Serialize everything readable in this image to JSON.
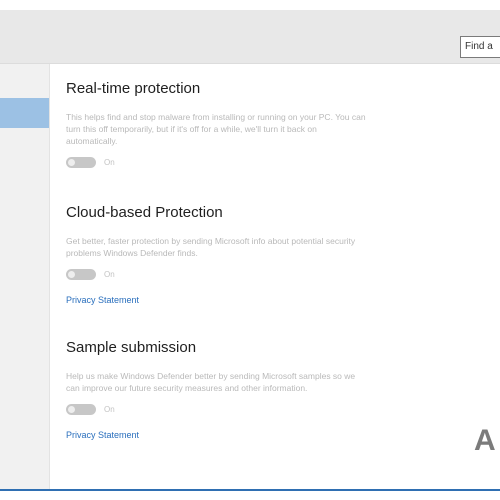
{
  "window": {
    "search": {
      "value": "Find a"
    }
  },
  "sections": [
    {
      "title": "Real-time protection",
      "description": "This helps find and stop malware from installing or running on your PC. You can turn this off temporarily, but if it's off for a while, we'll turn it back on automatically.",
      "toggle": {
        "state": "On",
        "value": true
      }
    },
    {
      "title": "Cloud-based Protection",
      "description": "Get better, faster protection by sending Microsoft info about potential security problems Windows Defender finds.",
      "toggle": {
        "state": "On",
        "value": true
      },
      "link": "Privacy Statement"
    },
    {
      "title": "Sample submission",
      "description": "Help us make Windows Defender better by sending Microsoft samples so we can improve our future security measures and other information.",
      "toggle": {
        "state": "On",
        "value": true
      },
      "link": "Privacy Statement"
    }
  ],
  "watermark": {
    "text": "A"
  },
  "colors": {
    "accent": "#2f6fb2",
    "sidebar_selected": "#9cc1e4",
    "link": "#2a6fbd"
  }
}
